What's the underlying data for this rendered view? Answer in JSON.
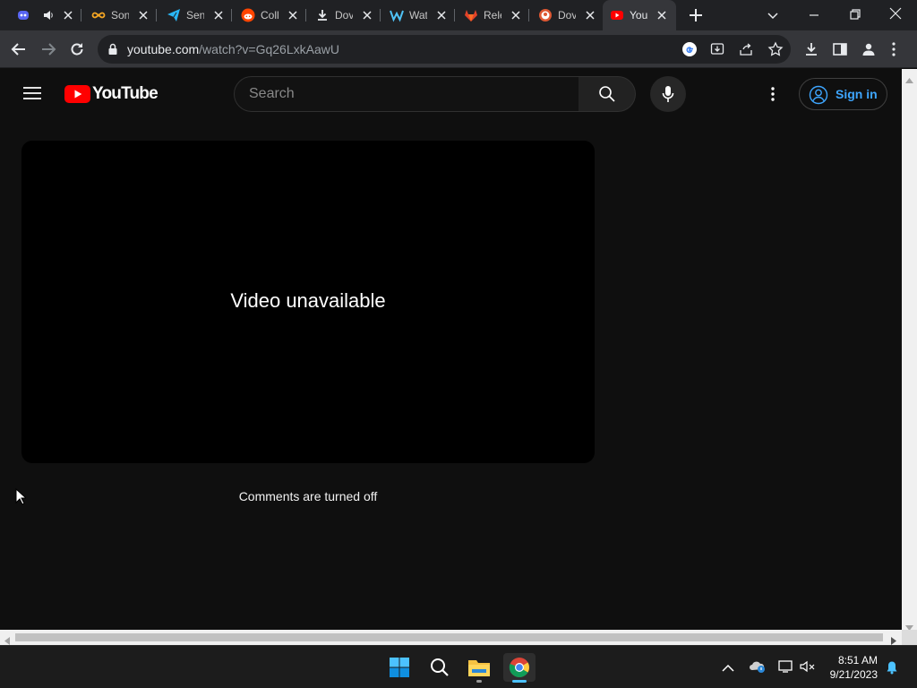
{
  "browser": {
    "tabs": [
      {
        "label": "",
        "icon": "discord-like-icon"
      },
      {
        "label": "Son",
        "icon": "infinity-icon"
      },
      {
        "label": "Sen",
        "icon": "telegram-icon"
      },
      {
        "label": "Coll",
        "icon": "reddit-icon"
      },
      {
        "label": "Dov",
        "icon": "download-icon"
      },
      {
        "label": "Wat",
        "icon": "w-logo-icon"
      },
      {
        "label": "Rele",
        "icon": "gitlab-icon"
      },
      {
        "label": "Dov",
        "icon": "duckduckgo-icon"
      },
      {
        "label": "YouT",
        "icon": "youtube-icon",
        "active": true
      }
    ],
    "url_host": "youtube.com",
    "url_path": "/watch?v=Gq26LxkAawU"
  },
  "youtube": {
    "logo_text": "YouTube",
    "search_placeholder": "Search",
    "sign_in_label": "Sign in",
    "video_message": "Video unavailable",
    "comments_message": "Comments are turned off",
    "accent_red": "#ff0000",
    "link_blue": "#3ea6ff"
  },
  "taskbar": {
    "time": "8:51 AM",
    "date": "9/21/2023",
    "apps": [
      "windows-start-icon",
      "search-icon",
      "file-explorer-icon",
      "chrome-icon"
    ]
  }
}
